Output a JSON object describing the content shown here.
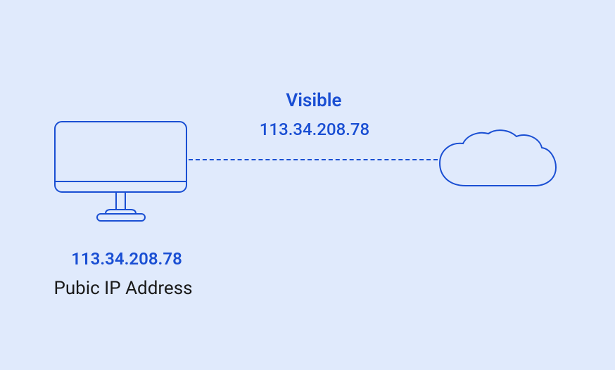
{
  "diagram": {
    "visible_label": "Visible",
    "visible_ip": "113.34.208.78",
    "computer_ip": "113.34.208.78",
    "ip_label": "Pubic IP Address"
  }
}
